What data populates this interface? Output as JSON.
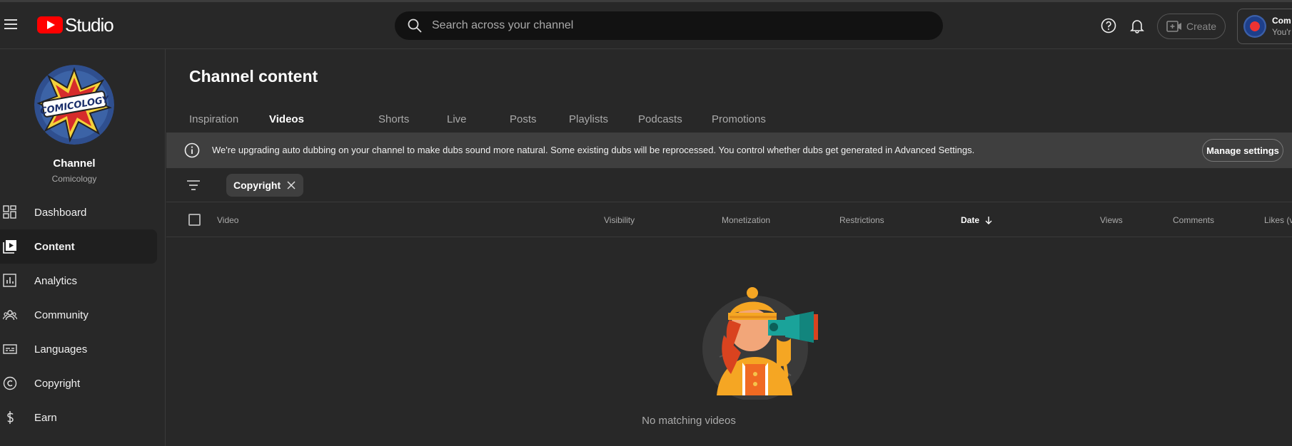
{
  "header": {
    "app_name": "Studio",
    "search_placeholder": "Search across your channel",
    "create_label": "Create",
    "account_name": "Com",
    "account_sub": "You'r"
  },
  "sidebar": {
    "channel_title": "Channel",
    "channel_name": "Comicology",
    "channel_logo_text": "COMICOLOGY",
    "items": [
      {
        "label": "Dashboard",
        "icon": "dashboard-icon",
        "active": false
      },
      {
        "label": "Content",
        "icon": "content-icon",
        "active": true
      },
      {
        "label": "Analytics",
        "icon": "analytics-icon",
        "active": false
      },
      {
        "label": "Community",
        "icon": "community-icon",
        "active": false
      },
      {
        "label": "Languages",
        "icon": "languages-icon",
        "active": false
      },
      {
        "label": "Copyright",
        "icon": "copyright-icon",
        "active": false
      },
      {
        "label": "Earn",
        "icon": "earn-icon",
        "active": false
      }
    ]
  },
  "main": {
    "title": "Channel content",
    "tabs": [
      "Inspiration",
      "Videos",
      "Shorts",
      "Live",
      "Posts",
      "Playlists",
      "Podcasts",
      "Promotions"
    ],
    "active_tab": "Videos",
    "banner_text": "We're upgrading auto dubbing on your channel to make dubs sound more natural. Some existing dubs will be reprocessed. You control whether dubs get generated in Advanced Settings.",
    "banner_button": "Manage settings",
    "filter_chip": "Copyright",
    "columns": [
      "Video",
      "Visibility",
      "Monetization",
      "Restrictions",
      "Date",
      "Views",
      "Comments",
      "Likes (v"
    ],
    "sorted_column": "Date",
    "empty_text": "No matching videos"
  },
  "colors": {
    "background": "#282828",
    "accent": "#ff0000",
    "banner": "#3f3f3f"
  }
}
